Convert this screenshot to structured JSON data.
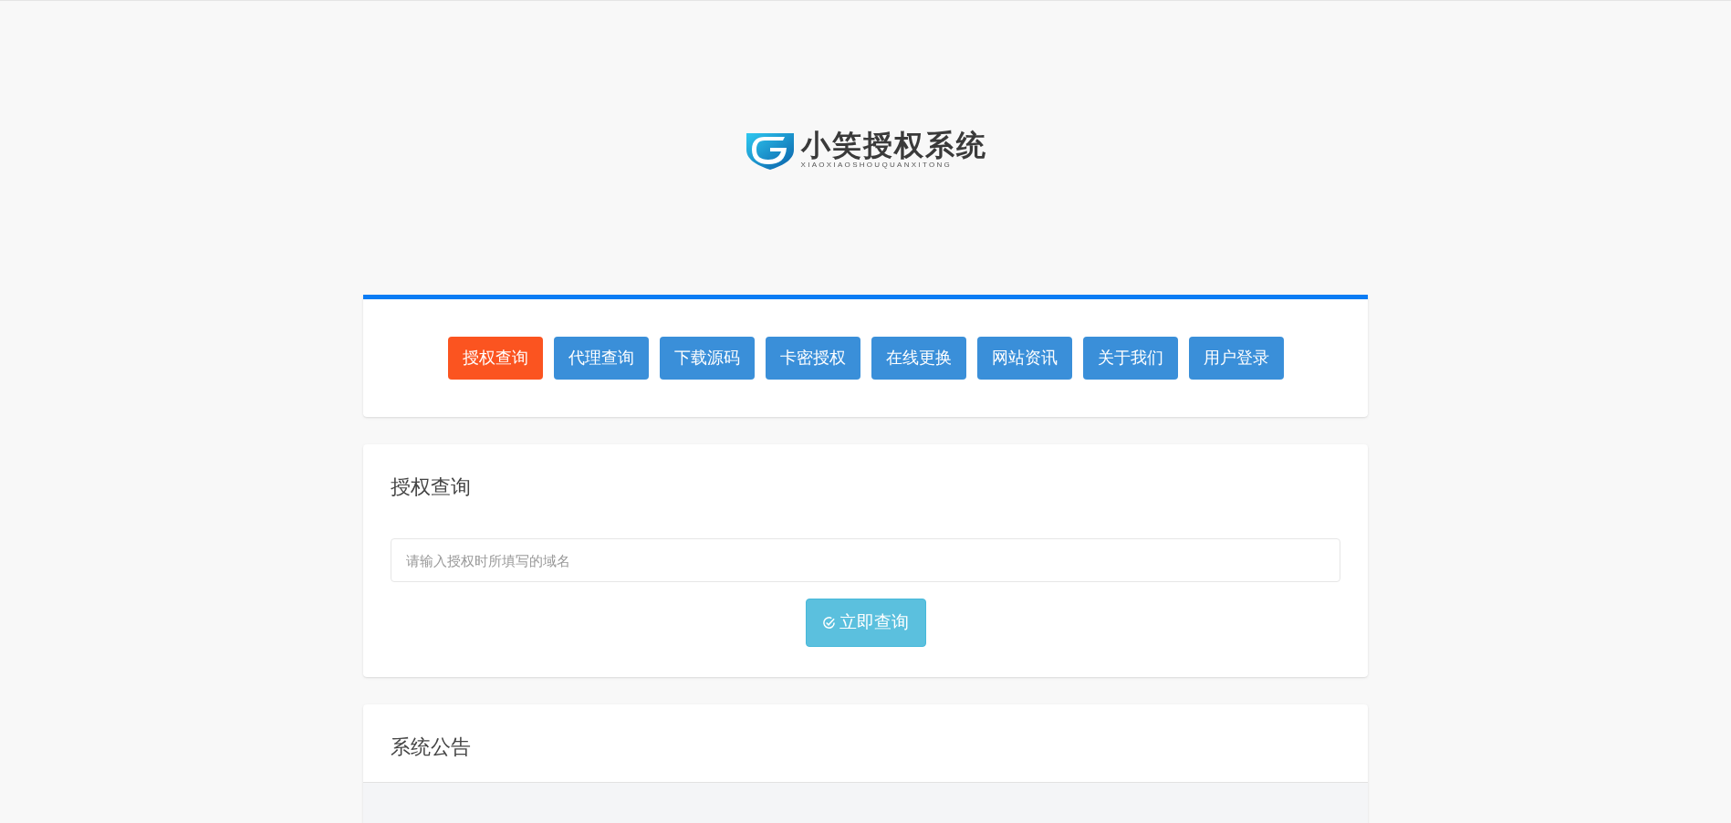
{
  "logo": {
    "title": "小笑授权系统",
    "subtitle": "XIAOXIAOSHOUQUANXITONG"
  },
  "nav": [
    {
      "label": "授权查询",
      "selected": true
    },
    {
      "label": "代理查询",
      "selected": false
    },
    {
      "label": "下载源码",
      "selected": false
    },
    {
      "label": "卡密授权",
      "selected": false
    },
    {
      "label": "在线更换",
      "selected": false
    },
    {
      "label": "网站资讯",
      "selected": false
    },
    {
      "label": "关于我们",
      "selected": false
    },
    {
      "label": "用户登录",
      "selected": false
    }
  ],
  "query": {
    "title": "授权查询",
    "placeholder": "请输入授权时所填写的域名",
    "button": "立即查询"
  },
  "notice": {
    "title": "系统公告"
  }
}
